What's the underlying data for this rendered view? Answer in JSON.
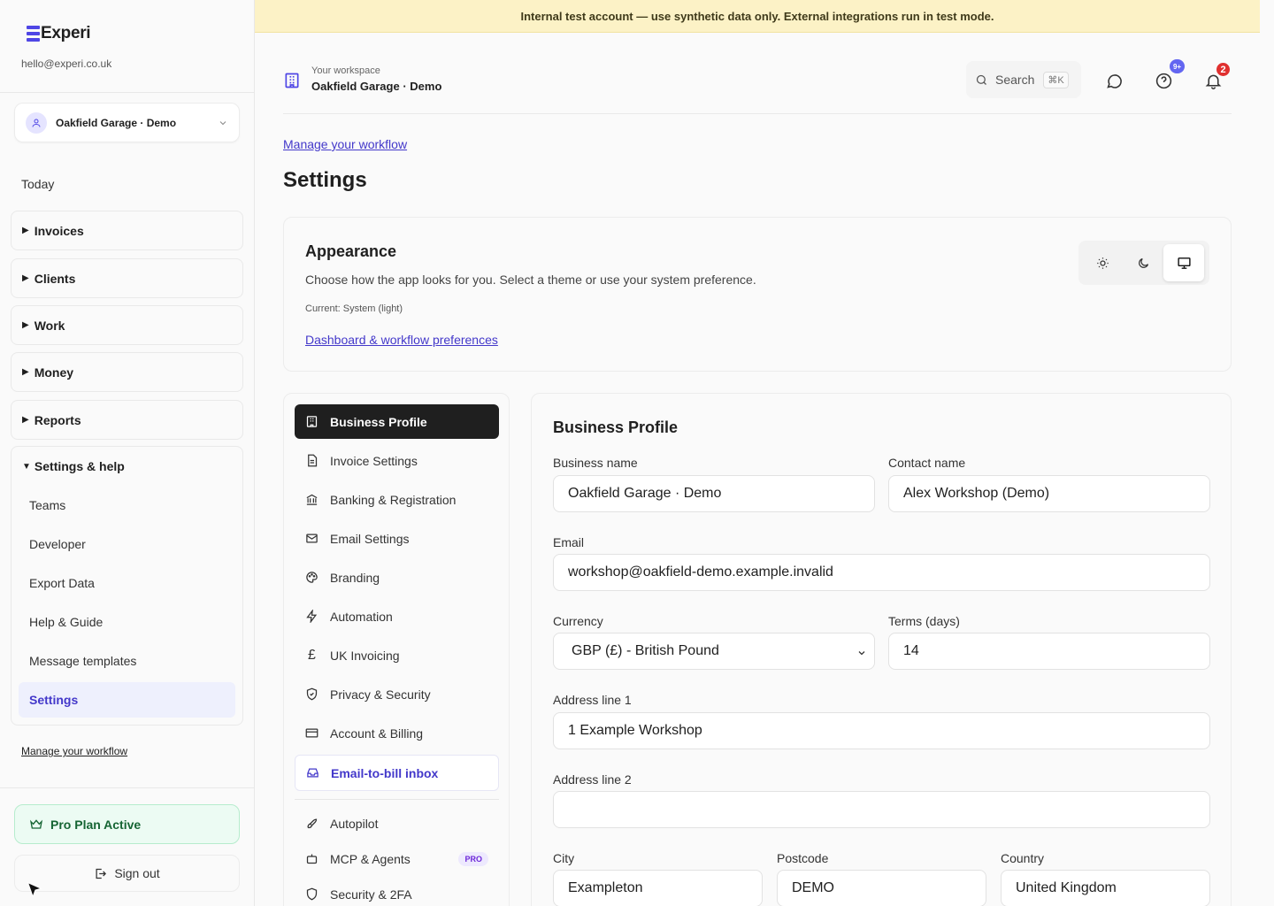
{
  "colors": {
    "accent": "#4f46e5",
    "link": "#4338ca",
    "banner_bg": "#fcf2c6",
    "pro_green": "#166534",
    "badge_red": "#e0302f",
    "badge_purple": "#6366f1"
  },
  "sidebar": {
    "logo_text": "Experi",
    "email": "hello@experi.co.uk",
    "workspace_selector": "Oakfield Garage · Demo",
    "today_label": "Today",
    "groups": [
      {
        "label": "Invoices"
      },
      {
        "label": "Clients"
      },
      {
        "label": "Work"
      },
      {
        "label": "Money"
      },
      {
        "label": "Reports"
      }
    ],
    "settings_group": {
      "label": "Settings & help",
      "items": [
        {
          "label": "Teams"
        },
        {
          "label": "Developer"
        },
        {
          "label": "Export Data"
        },
        {
          "label": "Help & Guide"
        },
        {
          "label": "Message templates"
        },
        {
          "label": "Settings"
        }
      ]
    },
    "manage_link": "Manage your workflow",
    "pro_badge": "Pro Plan Active",
    "sign_out": "Sign out"
  },
  "banner": {
    "text": "Internal test account — use synthetic data only. External integrations run in test mode."
  },
  "header": {
    "workspace_label": "Your workspace",
    "workspace_name": "Oakfield Garage · Demo",
    "search_placeholder": "Search",
    "search_shortcut": "⌘K",
    "help_badge": "9+",
    "notif_badge": "2"
  },
  "main": {
    "manage_link": "Manage your workflow",
    "title": "Settings",
    "appearance": {
      "title": "Appearance",
      "description": "Choose how the app looks for you. Select a theme or use your system preference.",
      "current": "Current: System (light)",
      "link": "Dashboard & workflow preferences",
      "themes": [
        "light",
        "dark",
        "system"
      ],
      "selected_theme": "system"
    },
    "settings_nav": [
      {
        "label": "Business Profile",
        "icon": "building-icon"
      },
      {
        "label": "Invoice Settings",
        "icon": "document-icon"
      },
      {
        "label": "Banking & Registration",
        "icon": "bank-icon"
      },
      {
        "label": "Email Settings",
        "icon": "mail-icon"
      },
      {
        "label": "Branding",
        "icon": "palette-icon"
      },
      {
        "label": "Automation",
        "icon": "zap-icon"
      },
      {
        "label": "UK Invoicing",
        "icon": "pound-icon"
      },
      {
        "label": "Privacy & Security",
        "icon": "shield-check-icon"
      },
      {
        "label": "Account & Billing",
        "icon": "credit-card-icon"
      },
      {
        "label": "Email-to-bill inbox",
        "icon": "inbox-icon"
      },
      {
        "label": "Autopilot",
        "icon": "rocket-icon"
      },
      {
        "label": "MCP & Agents",
        "icon": "bot-icon",
        "tag": "PRO"
      },
      {
        "label": "Security & 2FA",
        "icon": "shield-icon"
      }
    ],
    "business_profile": {
      "title": "Business Profile",
      "business_name_label": "Business name",
      "business_name": "Oakfield Garage · Demo",
      "contact_name_label": "Contact name",
      "contact_name": "Alex Workshop (Demo)",
      "email_label": "Email",
      "email": "workshop@oakfield-demo.example.invalid",
      "currency_label": "Currency",
      "currency": "GBP (£) - British Pound",
      "terms_label": "Terms (days)",
      "terms": "14",
      "address1_label": "Address line 1",
      "address1": "1 Example Workshop",
      "address2_label": "Address line 2",
      "address2": "",
      "city_label": "City",
      "city": "Exampleton",
      "postcode_label": "Postcode",
      "postcode": "DEMO",
      "country_label": "Country",
      "country": "United Kingdom"
    }
  }
}
